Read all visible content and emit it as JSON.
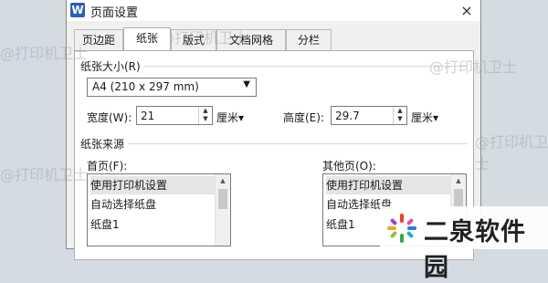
{
  "window": {
    "title": "页面设置",
    "app_icon": "W",
    "close_label": "×"
  },
  "tabs": [
    {
      "label": "页边距",
      "active": false
    },
    {
      "label": "纸张",
      "active": true
    },
    {
      "label": "版式",
      "active": false
    },
    {
      "label": "文档网格",
      "active": false
    },
    {
      "label": "分栏",
      "active": false
    }
  ],
  "paper_size": {
    "group_label": "纸张大小(R)",
    "selected": "A4 (210 x 297 mm)",
    "width_label": "宽度(W):",
    "width_value": "21",
    "height_label": "高度(E):",
    "height_value": "29.7",
    "unit_label": "厘米▾"
  },
  "paper_source": {
    "group_label": "纸张来源",
    "first_page_label": "首页(F):",
    "first_page_items": [
      "使用打印机设置",
      "自动选择纸盘",
      "纸盘1"
    ],
    "other_pages_label": "其他页(O):",
    "other_pages_items": [
      "使用打印机设置",
      "自动选择纸盘",
      "纸盘1"
    ]
  },
  "watermarks": [
    "@打印机卫士",
    "@打印机卫士",
    "@打印机卫士",
    "@打印机卫士",
    "@打印机卫士"
  ],
  "brand": {
    "text": "二泉软件园"
  },
  "colors": {
    "accent": "#2b5fb4",
    "background": "#d4dbe3"
  }
}
